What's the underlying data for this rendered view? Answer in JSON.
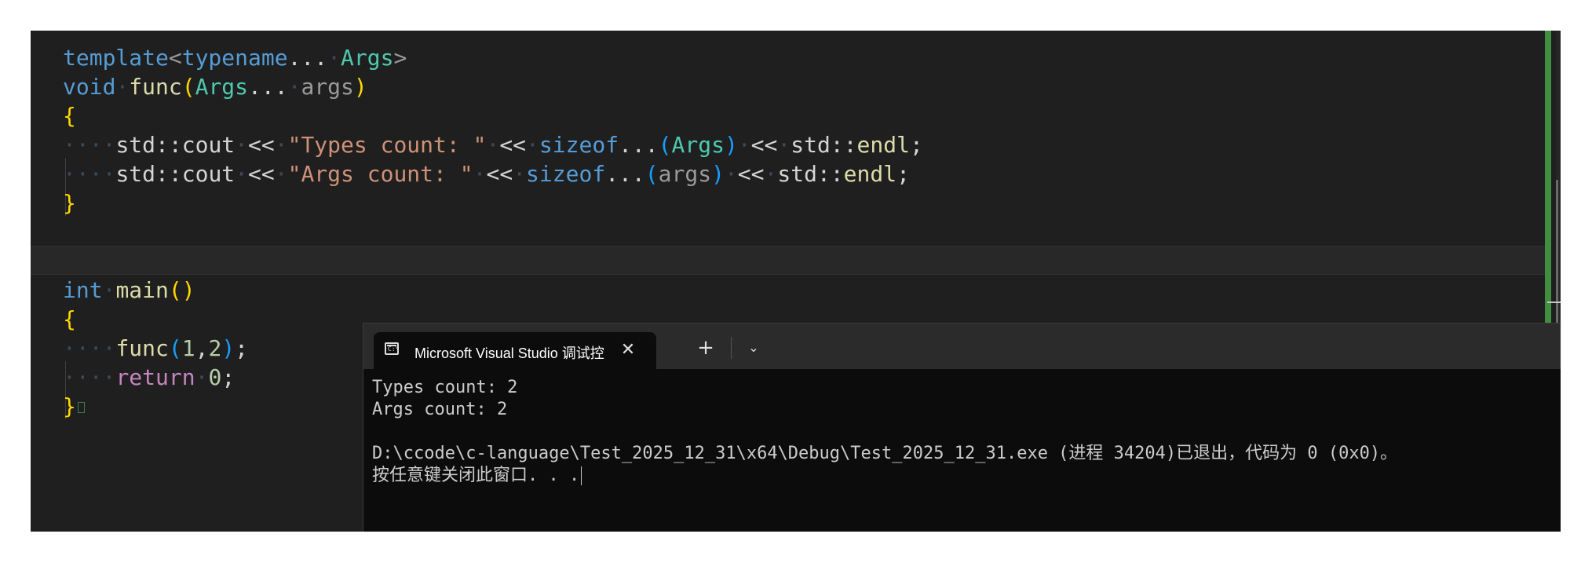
{
  "editor": {
    "lines": {
      "l1": {
        "kw_template": "template",
        "lt": "<",
        "kw_typename": "typename",
        "ellipsis": "...",
        "ty_args": "Args",
        "gt": ">"
      },
      "l2": {
        "kw_void": "void",
        "fn_func": "func",
        "lp": "(",
        "ty_args": "Args",
        "ellipsis": "...",
        "param": "args",
        "rp": ")"
      },
      "l3": {
        "brace": "{"
      },
      "l4": {
        "ns": "std::cout",
        "op1": "<<",
        "str": "\"Types count: \"",
        "op2": "<<",
        "kw_sizeof": "sizeof",
        "ellipsis": "...",
        "lp": "(",
        "ty_args": "Args",
        "rp": ")",
        "op3": "<<",
        "ns2": "std::",
        "endl": "endl",
        "semi": ";"
      },
      "l5": {
        "ns": "std::cout",
        "op1": "<<",
        "str": "\"Args count: \"",
        "op2": "<<",
        "kw_sizeof": "sizeof",
        "ellipsis": "...",
        "lp": "(",
        "param": "args",
        "rp": ")",
        "op3": "<<",
        "ns2": "std::",
        "endl": "endl",
        "semi": ";"
      },
      "l6": {
        "brace": "}"
      },
      "l9": {
        "kw_int": "int",
        "fn_main": "main",
        "parens": "()"
      },
      "l10": {
        "brace": "{"
      },
      "l11": {
        "fn_func": "func",
        "lp": "(",
        "n1": "1",
        "comma": ",",
        "n2": "2",
        "rp": ")",
        "semi": ";"
      },
      "l12": {
        "kw_return": "return",
        "n0": "0",
        "semi": ";"
      },
      "l13": {
        "brace": "}"
      }
    }
  },
  "console": {
    "tab_title": "Microsoft Visual Studio 调试控",
    "tab_icon": "C:\\",
    "close_glyph": "✕",
    "new_tab_glyph": "+",
    "dropdown_glyph": "⌄",
    "output": [
      "Types count: 2",
      "Args count: 2",
      "",
      "D:\\ccode\\c-language\\Test_2025_12_31\\x64\\Debug\\Test_2025_12_31.exe (进程 34204)已退出，代码为 0 (0x0)。",
      "按任意键关闭此窗口. . ."
    ]
  }
}
